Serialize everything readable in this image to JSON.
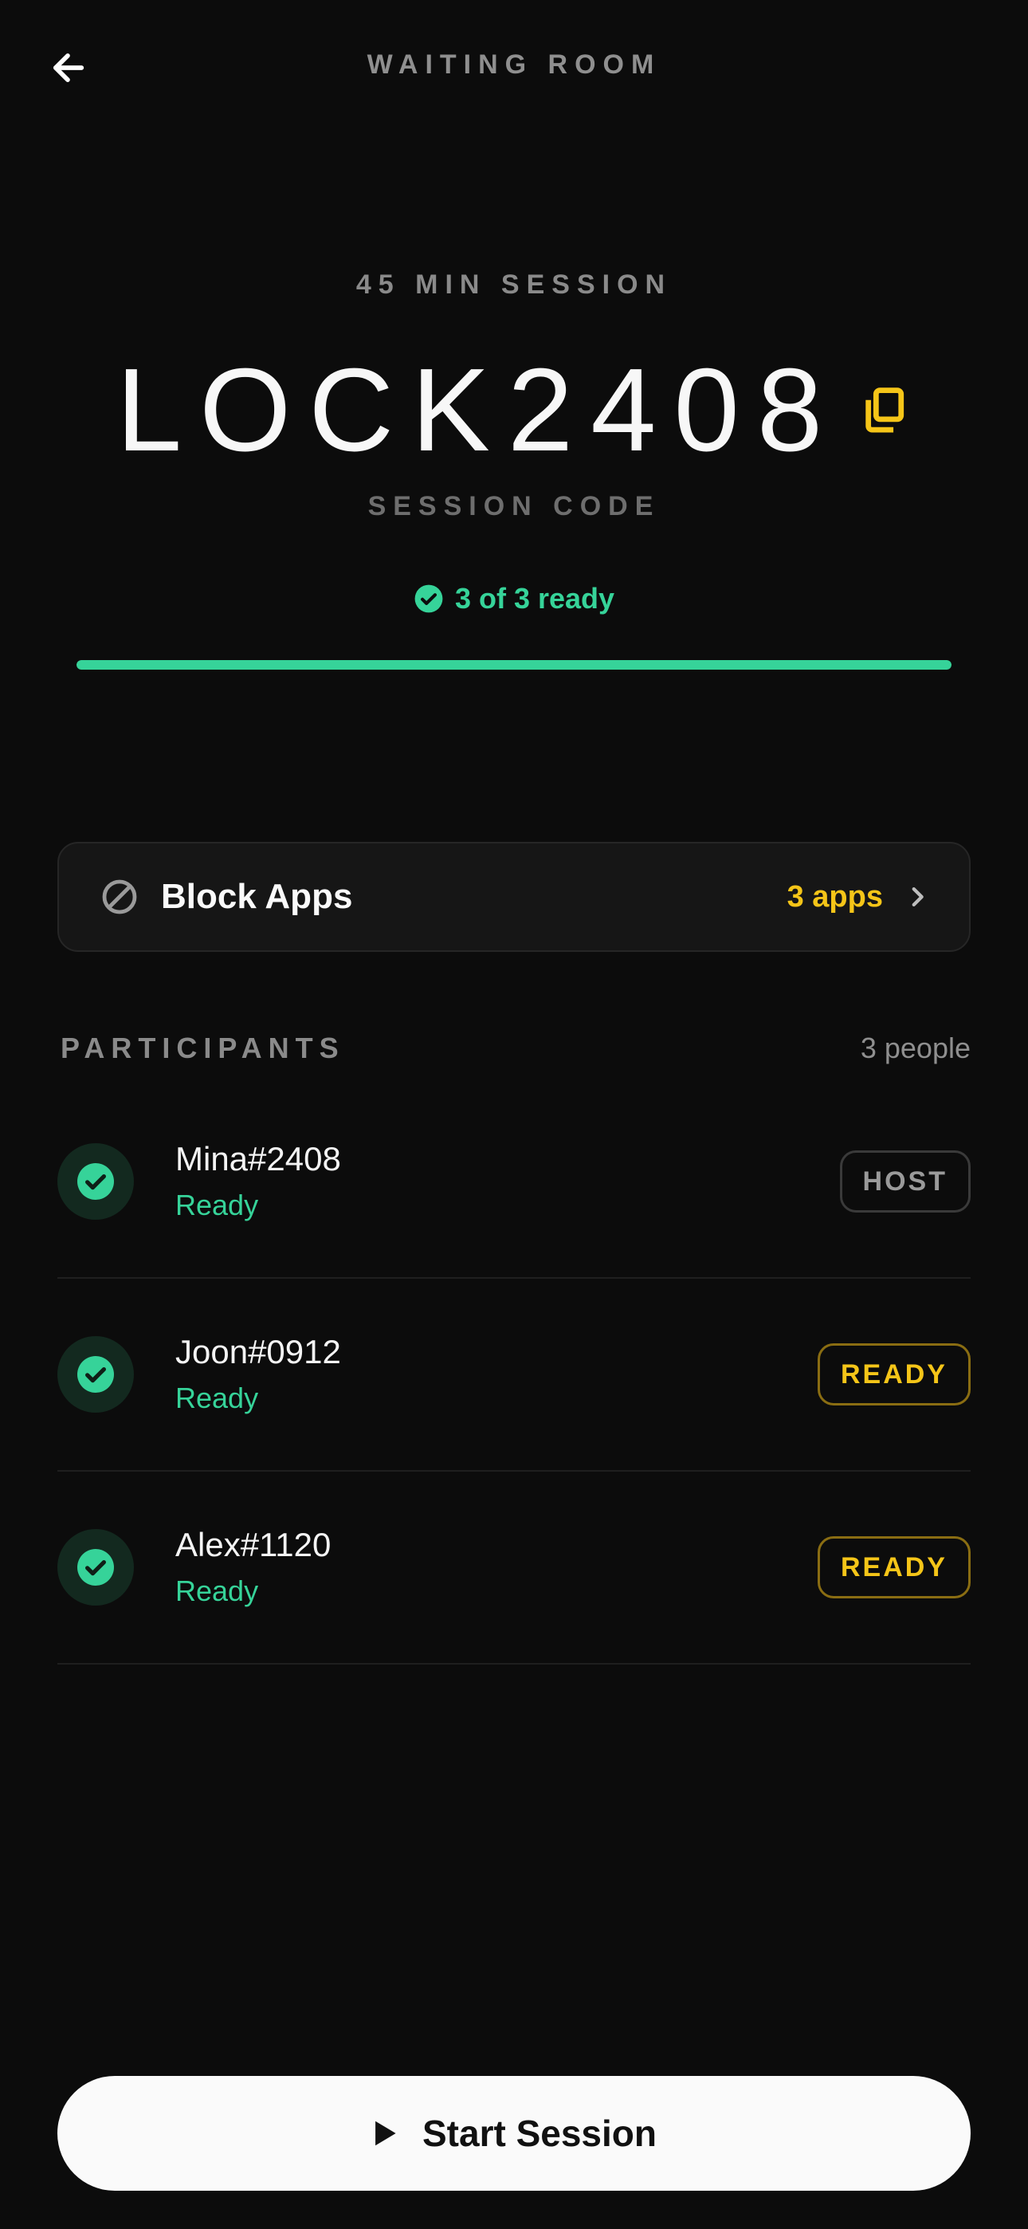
{
  "header": {
    "title": "WAITING ROOM"
  },
  "session": {
    "duration_label": "45 MIN SESSION",
    "code": "LOCK2408",
    "code_label": "SESSION CODE",
    "ready_text": "3 of 3 ready",
    "ready_count": 3,
    "total_count": 3,
    "progress_fraction": 1.0
  },
  "block_apps": {
    "label": "Block Apps",
    "count_label": "3 apps"
  },
  "participants": {
    "title": "PARTICIPANTS",
    "count_label": "3 people",
    "items": [
      {
        "name": "Mina#2408",
        "status": "Ready",
        "badge": "HOST",
        "badge_type": "host"
      },
      {
        "name": "Joon#0912",
        "status": "Ready",
        "badge": "READY",
        "badge_type": "ready"
      },
      {
        "name": "Alex#1120",
        "status": "Ready",
        "badge": "READY",
        "badge_type": "ready"
      }
    ]
  },
  "start_button": {
    "label": "Start Session"
  },
  "colors": {
    "background": "#0c0c0c",
    "accent_green": "#36d399",
    "accent_yellow": "#f5c518",
    "button_bg": "#fafafa"
  },
  "icons": {
    "back": "arrow-left-icon",
    "copy": "copy-icon",
    "ready_check": "check-circle-icon",
    "block": "block-icon",
    "chevron": "chevron-right-icon",
    "play": "play-icon"
  }
}
